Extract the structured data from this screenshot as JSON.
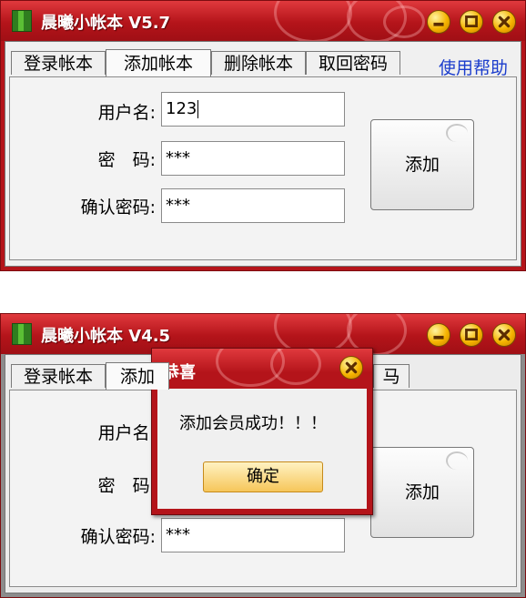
{
  "top": {
    "title": "晨曦小帐本 V5.7",
    "tabs": [
      "登录帐本",
      "添加帐本",
      "删除帐本",
      "取回密码"
    ],
    "active_tab": 1,
    "help": "使用帮助",
    "fields": {
      "username_label": "用户名:",
      "username_value": "123",
      "password_label": "密　码:",
      "password_value": "***",
      "confirm_label": "确认密码:",
      "confirm_value": "***"
    },
    "add_button": "添加"
  },
  "bottom": {
    "title": "晨曦小帐本 V4.5",
    "tabs": [
      "登录帐本",
      "添加"
    ],
    "tab_fragment": "马",
    "fields": {
      "username_label": "用户名:",
      "password_label": "密　码:",
      "confirm_label": "确认密码:",
      "confirm_value": "***"
    },
    "add_button": "添加"
  },
  "dialog": {
    "title": "恭喜",
    "message": "添加会员成功！！！",
    "ok_button": "确定"
  },
  "colors": {
    "titlebar": "#b4141a",
    "button_gold": "#f5b400",
    "link_blue": "#1a3ccc"
  },
  "icons": [
    "app-icon",
    "minimize-icon",
    "maximize-icon",
    "close-icon"
  ]
}
